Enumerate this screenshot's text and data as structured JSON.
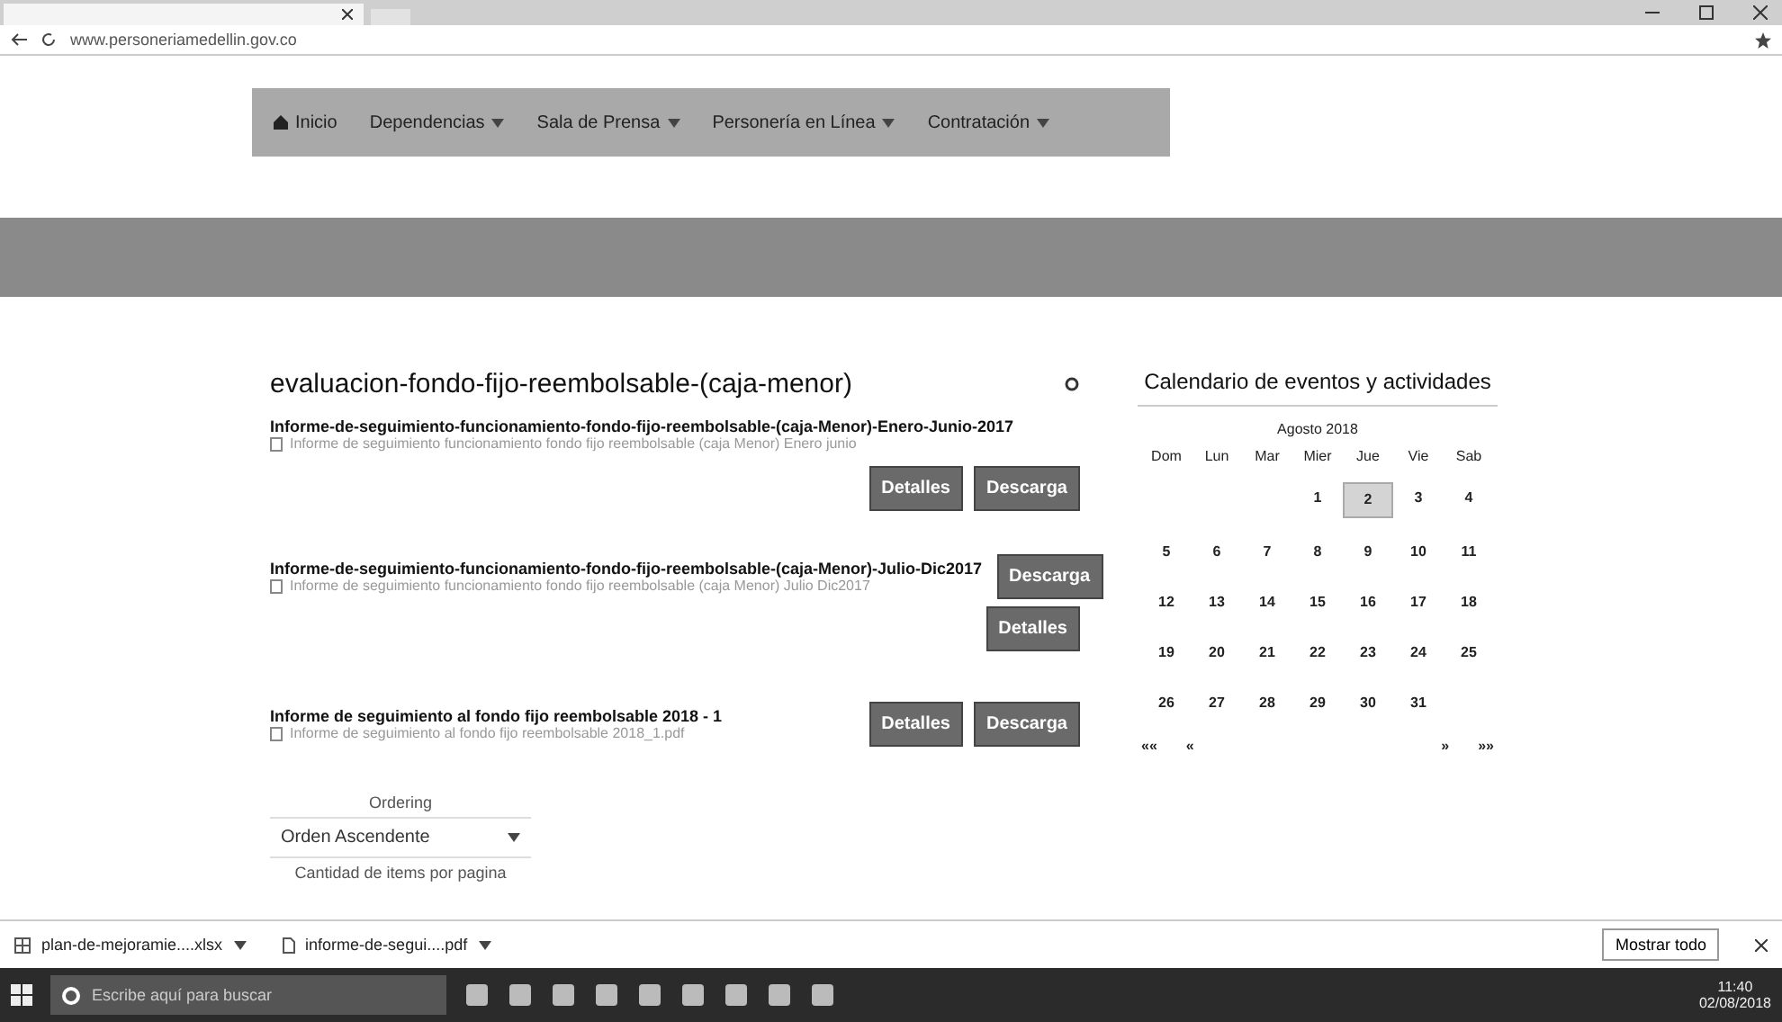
{
  "browser": {
    "url": "www.personeriamedellin.gov.co"
  },
  "nav": [
    {
      "label": "Inicio",
      "kind": "home",
      "dropdown": false
    },
    {
      "label": "Dependencias",
      "kind": "link",
      "dropdown": true
    },
    {
      "label": "Sala de Prensa",
      "kind": "link",
      "dropdown": true
    },
    {
      "label": "Personería en Línea",
      "kind": "link",
      "dropdown": true
    },
    {
      "label": "Contratación",
      "kind": "link",
      "dropdown": true
    }
  ],
  "category": {
    "title": "evaluacion-fondo-fijo-reembolsable-(caja-menor)"
  },
  "documents": [
    {
      "title": "Informe-de-seguimiento-funcionamiento-fondo-fijo-reembolsable-(caja-Menor)-Enero-Junio-2017",
      "file": "Informe de seguimiento funcionamiento fondo fijo reembolsable (caja Menor) Enero junio",
      "kind": "below",
      "buttons": [
        "Detalles",
        "Descarga"
      ]
    },
    {
      "title": "Informe-de-seguimiento-funcionamiento-fondo-fijo-reembolsable-(caja-Menor)-Julio-Dic2017",
      "file": "Informe de seguimiento funcionamiento fondo fijo reembolsable (caja Menor) Julio Dic2017",
      "kind": "split",
      "buttons": [
        "Descarga",
        "Detalles"
      ]
    },
    {
      "title": "Informe de seguimiento al fondo fijo reembolsable 2018 - 1",
      "file": "Informe de seguimiento al fondo fijo reembolsable 2018_1.pdf",
      "kind": "inline",
      "buttons": [
        "Detalles",
        "Descarga"
      ]
    }
  ],
  "ordering": {
    "label": "Ordering",
    "value": "Orden Ascendente",
    "note": "Cantidad de items por pagina"
  },
  "calendar": {
    "title": "Calendario de eventos y actividades",
    "month": "Agosto 2018",
    "weekdays": [
      "Dom",
      "Lun",
      "Mar",
      "Mier",
      "Jue",
      "Vie",
      "Sab"
    ],
    "weeks": [
      [
        {
          "d": "1",
          "selected": false
        },
        {
          "d": "2",
          "selected": true
        },
        {
          "d": "3",
          "selected": false
        },
        {
          "d": "4",
          "selected": false
        }
      ],
      [
        {
          "d": "5",
          "selected": false
        },
        {
          "d": "6",
          "selected": false
        },
        {
          "d": "7",
          "selected": false
        },
        {
          "d": "8",
          "selected": false
        },
        {
          "d": "9",
          "selected": false
        },
        {
          "d": "10",
          "selected": false
        },
        {
          "d": "11",
          "selected": false
        }
      ],
      [
        {
          "d": "12",
          "selected": false
        },
        {
          "d": "13",
          "selected": false
        },
        {
          "d": "14",
          "selected": false
        },
        {
          "d": "15",
          "selected": false
        },
        {
          "d": "16",
          "selected": false
        },
        {
          "d": "17",
          "selected": false
        },
        {
          "d": "18",
          "selected": false
        }
      ],
      [
        {
          "d": "19",
          "selected": false
        },
        {
          "d": "20",
          "selected": false
        },
        {
          "d": "21",
          "selected": false
        },
        {
          "d": "22",
          "selected": false
        },
        {
          "d": "23",
          "selected": false
        },
        {
          "d": "24",
          "selected": false
        },
        {
          "d": "25",
          "selected": false
        }
      ],
      [
        {
          "d": "26",
          "selected": false
        },
        {
          "d": "27",
          "selected": false
        },
        {
          "d": "28",
          "selected": false
        },
        {
          "d": "29",
          "selected": false
        },
        {
          "d": "30",
          "selected": false
        },
        {
          "d": "31",
          "selected": false
        }
      ]
    ],
    "nav_left": [
      "««",
      "«"
    ],
    "nav_right": [
      "»",
      "»»"
    ]
  },
  "downloads": {
    "items": [
      {
        "name": "plan-de-mejoramie....xlsx",
        "kind": "sheet"
      },
      {
        "name": "informe-de-segui....pdf",
        "kind": "pdf"
      }
    ],
    "show_all": "Mostrar todo"
  },
  "taskbar": {
    "search_placeholder": "Escribe aquí para buscar",
    "time": "11:40",
    "date": "02/08/2018"
  }
}
